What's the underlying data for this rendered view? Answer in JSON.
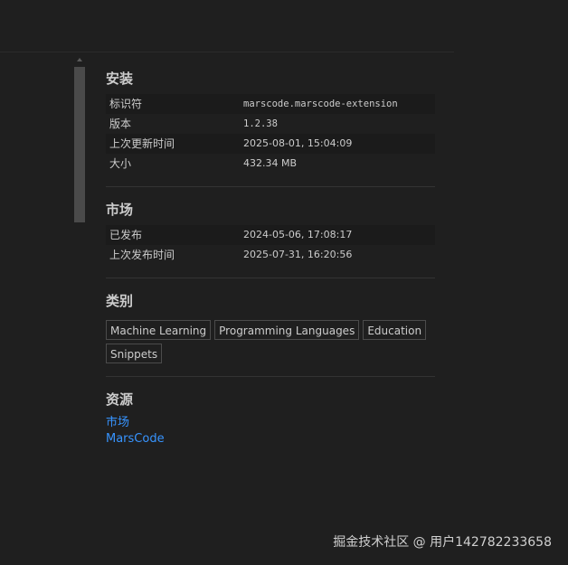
{
  "install": {
    "title": "安装",
    "rows": [
      {
        "label": "标识符",
        "value": "marscode.marscode-extension"
      },
      {
        "label": "版本",
        "value": "1.2.38"
      },
      {
        "label": "上次更新时间",
        "value": "2025-08-01, 15:04:09"
      },
      {
        "label": "大小",
        "value": "432.34 MB"
      }
    ]
  },
  "marketplace": {
    "title": "市场",
    "rows": [
      {
        "label": "已发布",
        "value": "2024-05-06, 17:08:17"
      },
      {
        "label": "上次发布时间",
        "value": "2025-07-31, 16:20:56"
      }
    ]
  },
  "categories": {
    "title": "类别",
    "tags": [
      "Machine Learning",
      "Programming Languages",
      "Education",
      "Snippets"
    ]
  },
  "resources": {
    "title": "资源",
    "links": [
      "市场",
      "MarsCode"
    ]
  },
  "watermark": "掘金技术社区 @ 用户142782233658",
  "colors": {
    "background": "#1f1f1f",
    "link": "#3794ff",
    "text": "#cccccc"
  }
}
